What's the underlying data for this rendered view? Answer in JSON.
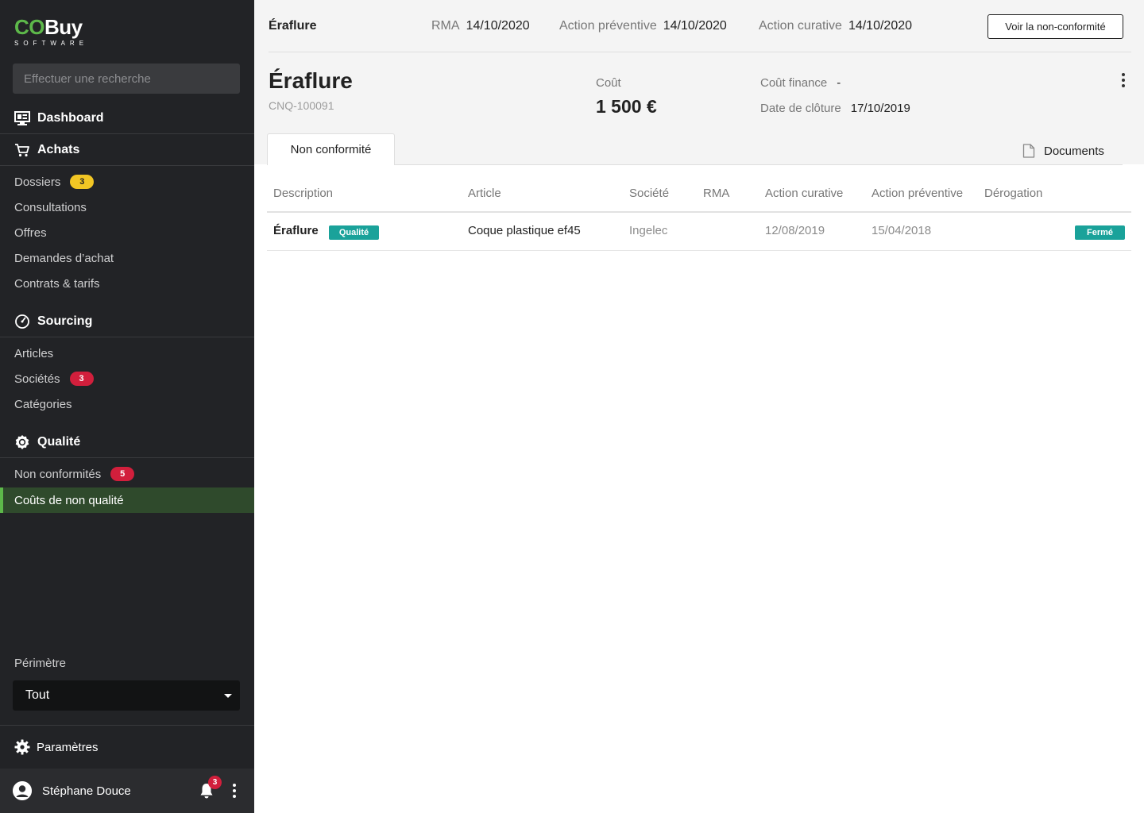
{
  "brand": {
    "part1": "CO",
    "part2": "Buy",
    "sub": "SOFTWARE"
  },
  "search": {
    "placeholder": "Effectuer une recherche"
  },
  "nav": {
    "dashboard": "Dashboard",
    "achats": {
      "label": "Achats",
      "items": [
        {
          "label": "Dossiers",
          "badge": "3"
        },
        {
          "label": "Consultations"
        },
        {
          "label": "Offres"
        },
        {
          "label": "Demandes d’achat"
        },
        {
          "label": "Contrats & tarifs"
        }
      ]
    },
    "sourcing": {
      "label": "Sourcing",
      "items": [
        {
          "label": "Articles"
        },
        {
          "label": "Sociétés",
          "badge": "3"
        },
        {
          "label": "Catégories"
        }
      ]
    },
    "qualite": {
      "label": "Qualité",
      "items": [
        {
          "label": "Non conformités",
          "badge": "5"
        },
        {
          "label": "Coûts de non qualité"
        }
      ]
    }
  },
  "perimetre": {
    "label": "Périmètre",
    "value": "Tout"
  },
  "settings": "Paramètres",
  "user": {
    "name": "Stéphane Douce",
    "notifications": "3"
  },
  "topbar": {
    "title": "Éraflure",
    "rma_label": "RMA",
    "rma_value": "14/10/2020",
    "preventive_label": "Action préventive",
    "preventive_value": "14/10/2020",
    "curative_label": "Action curative",
    "curative_value": "14/10/2020",
    "button": "Voir la non-conformité"
  },
  "record": {
    "title": "Éraflure",
    "ref": "CNQ-100091",
    "cost_label": "Coût",
    "cost_value": "1 500 €",
    "finance_label": "Coût finance",
    "finance_value": "-",
    "closing_label": "Date de clôture",
    "closing_value": "17/10/2019"
  },
  "tabs": {
    "active": "Non conformité",
    "documents": "Documents"
  },
  "table": {
    "headers": [
      "Description",
      "Article",
      "Société",
      "RMA",
      "Action curative",
      "Action préventive",
      "Dérogation"
    ],
    "rows": [
      {
        "description": "Éraflure",
        "tag": "Qualité",
        "article": "Coque plastique ef45",
        "societe": "Ingelec",
        "rma": "",
        "curative": "12/08/2019",
        "preventive": "15/04/2018",
        "derogation": "",
        "status": "Fermé"
      }
    ]
  },
  "colors": {
    "brand_green": "#5db84a",
    "teal": "#1aa29a",
    "badge_red": "#d21f3c",
    "badge_yellow": "#f2c624",
    "sidebar_bg": "#222326"
  }
}
